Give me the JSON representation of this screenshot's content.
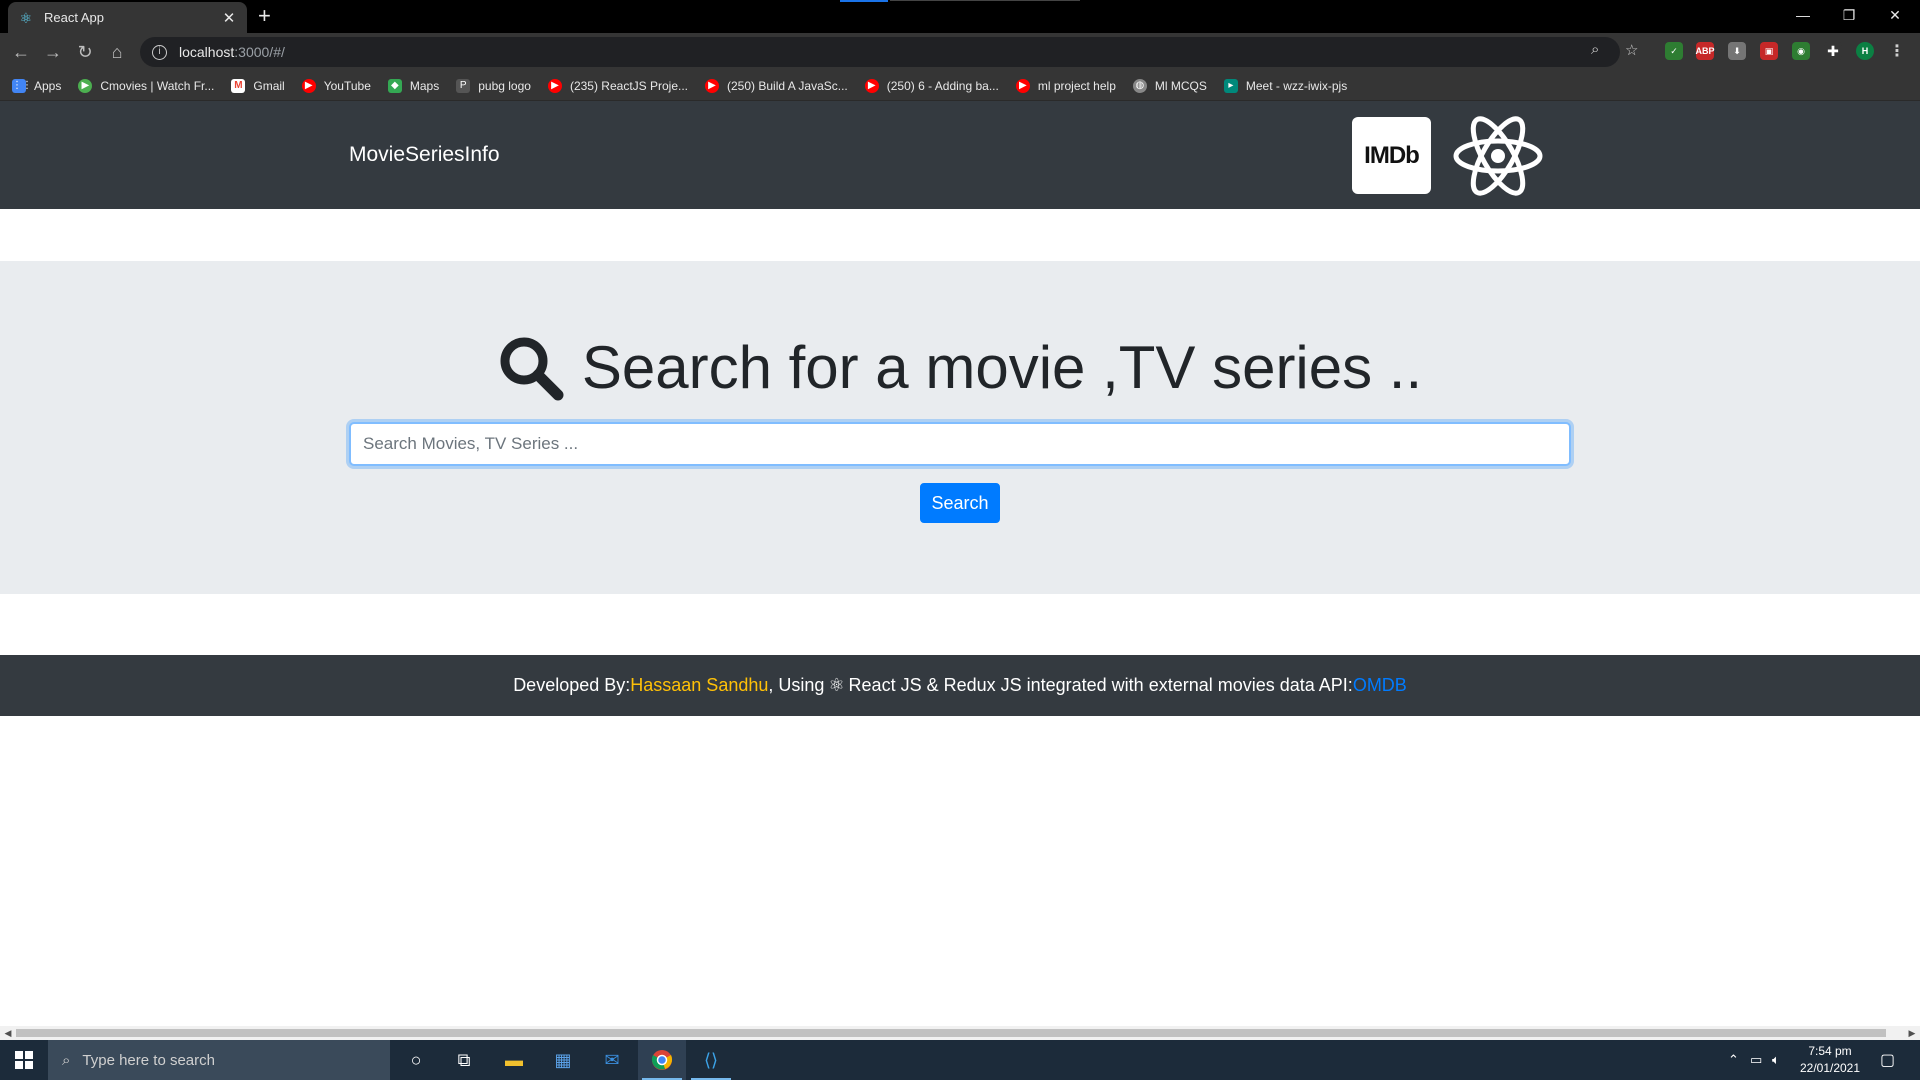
{
  "browser": {
    "tab_title": "React App",
    "close_symbol": "✕",
    "newtab_symbol": "+",
    "url_host": "localhost",
    "url_path": ":3000/#/",
    "window_controls": {
      "minimize": "—",
      "restore": "❐",
      "close": "✕"
    },
    "bookmarks": [
      {
        "label": "Apps",
        "icon": "apps-grid-icon",
        "color": "#4285f4"
      },
      {
        "label": "Cmovies | Watch Fr...",
        "icon": "cmovies-icon",
        "color": "#4caf50"
      },
      {
        "label": "Gmail",
        "icon": "gmail-icon",
        "color": "#ea4335"
      },
      {
        "label": "YouTube",
        "icon": "youtube-icon",
        "color": "#ff0000"
      },
      {
        "label": "Maps",
        "icon": "maps-icon",
        "color": "#34a853"
      },
      {
        "label": "pubg logo",
        "icon": "pubg-icon",
        "color": "#555555"
      },
      {
        "label": "(235) ReactJS Proje...",
        "icon": "youtube-icon",
        "color": "#ff0000"
      },
      {
        "label": "(250) Build A JavaSc...",
        "icon": "youtube-icon",
        "color": "#ff0000"
      },
      {
        "label": "(250) 6 - Adding ba...",
        "icon": "youtube-icon",
        "color": "#ff0000"
      },
      {
        "label": "ml project help",
        "icon": "youtube-icon",
        "color": "#ff0000"
      },
      {
        "label": "Ml MCQS",
        "icon": "globe-icon",
        "color": "#888888"
      },
      {
        "label": "Meet - wzz-iwix-pjs",
        "icon": "meet-icon",
        "color": "#00897b"
      }
    ],
    "extensions": [
      {
        "name": "shield-extension-icon",
        "text": "✓",
        "color": "#2e7d32"
      },
      {
        "name": "adblock-extension-icon",
        "text": "ABP",
        "color": "#c62828"
      },
      {
        "name": "download-extension-icon",
        "text": "⬇",
        "color": "#757575"
      },
      {
        "name": "red-extension-icon",
        "text": "▣",
        "color": "#c62828"
      },
      {
        "name": "green-circle-extension-icon",
        "text": "◉",
        "color": "#2e7d32"
      },
      {
        "name": "puzzle-extensions-icon",
        "text": "✚",
        "color": "#353535"
      },
      {
        "name": "profile-avatar",
        "text": "H",
        "color": "#0b8043"
      }
    ]
  },
  "app": {
    "brand": "MovieSeriesInfo",
    "imdb_logo": "IMDb",
    "headline": "Search for a movie ,TV series ..",
    "search_placeholder": "Search Movies, TV Series ...",
    "search_button": "Search",
    "footer": {
      "prefix": "Developed By:",
      "developer": "Hassaan Sandhu",
      "middle_before_icon": ", Using",
      "middle_after_icon": "React JS & Redux JS integrated with external movies data API:",
      "api": "OMDB"
    },
    "colors": {
      "navbar": "#343a40",
      "jumbotron": "#e9ecef",
      "primary": "#007bff",
      "warning": "#ffc107"
    }
  },
  "taskbar": {
    "search_placeholder": "Type here to search",
    "time": "7:54 pm",
    "date": "22/01/2021"
  }
}
